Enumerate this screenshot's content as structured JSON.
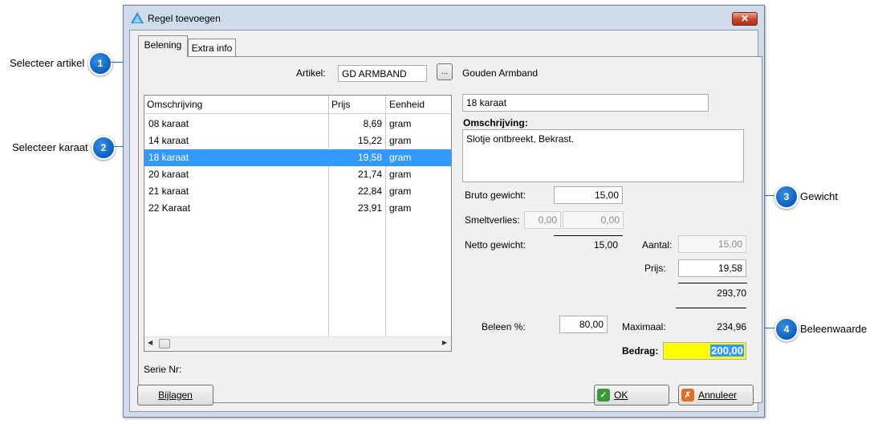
{
  "callouts": [
    {
      "number": "1",
      "label": "Selecteer artikel"
    },
    {
      "number": "2",
      "label": "Selecteer karaat"
    },
    {
      "number": "3",
      "label": "Gewicht"
    },
    {
      "number": "4",
      "label": "Beleenwaarde"
    }
  ],
  "window": {
    "title": "Regel toevoegen",
    "close_label": "✕"
  },
  "tabs": [
    {
      "label": "Belening",
      "active": true
    },
    {
      "label": "Extra info",
      "active": false
    }
  ],
  "artikel": {
    "label": "Artikel:",
    "value": "GD ARMBAND",
    "browse_label": "...",
    "description": "Gouden Armband"
  },
  "list": {
    "columns": [
      "Omschrijving",
      "Prijs",
      "Eenheid"
    ],
    "rows": [
      {
        "omschrijving": "08 karaat",
        "prijs": "8,69",
        "eenheid": "gram",
        "selected": false
      },
      {
        "omschrijving": "14 karaat",
        "prijs": "15,22",
        "eenheid": "gram",
        "selected": false
      },
      {
        "omschrijving": "18 karaat",
        "prijs": "19,58",
        "eenheid": "gram",
        "selected": true
      },
      {
        "omschrijving": "20 karaat",
        "prijs": "21,74",
        "eenheid": "gram",
        "selected": false
      },
      {
        "omschrijving": "21 karaat",
        "prijs": "22,84",
        "eenheid": "gram",
        "selected": false
      },
      {
        "omschrijving": "22 Karaat",
        "prijs": "23,91",
        "eenheid": "gram",
        "selected": false
      }
    ],
    "scroll_left": "◀",
    "scroll_right": "▶"
  },
  "detail": {
    "selected_karaat": "18 karaat",
    "omschrijving_label": "Omschrijving:",
    "omschrijving_value": "Slotje ontbreekt, Bekrast.",
    "bruto_label": "Bruto gewicht:",
    "bruto_value": "15,00",
    "smelt_label": "Smeltverlies:",
    "smelt_value1": "0,00",
    "smelt_value2": "0,00",
    "netto_label": "Netto gewicht:",
    "netto_value": "15,00",
    "aantal_label": "Aantal:",
    "aantal_value": "15,00",
    "prijs_label": "Prijs:",
    "prijs_value": "19,58",
    "subtotaal": "293,70",
    "beleen_label": "Beleen %:",
    "beleen_value": "80,00",
    "maximaal_label": "Maximaal:",
    "maximaal_value": "234,96",
    "bedrag_label": "Bedrag:",
    "bedrag_value": "200,00",
    "serie_label": "Serie Nr:"
  },
  "buttons": {
    "bijlagen": "Bijlagen",
    "ok": "OK",
    "annuleer": "Annuleer"
  },
  "colors": {
    "selection": "#3399ff",
    "bedrag_highlight": "#ffff00",
    "callout_badge": "#1a73d6",
    "ok_icon": "#3a9a3a",
    "annuleer_icon": "#e07020"
  }
}
